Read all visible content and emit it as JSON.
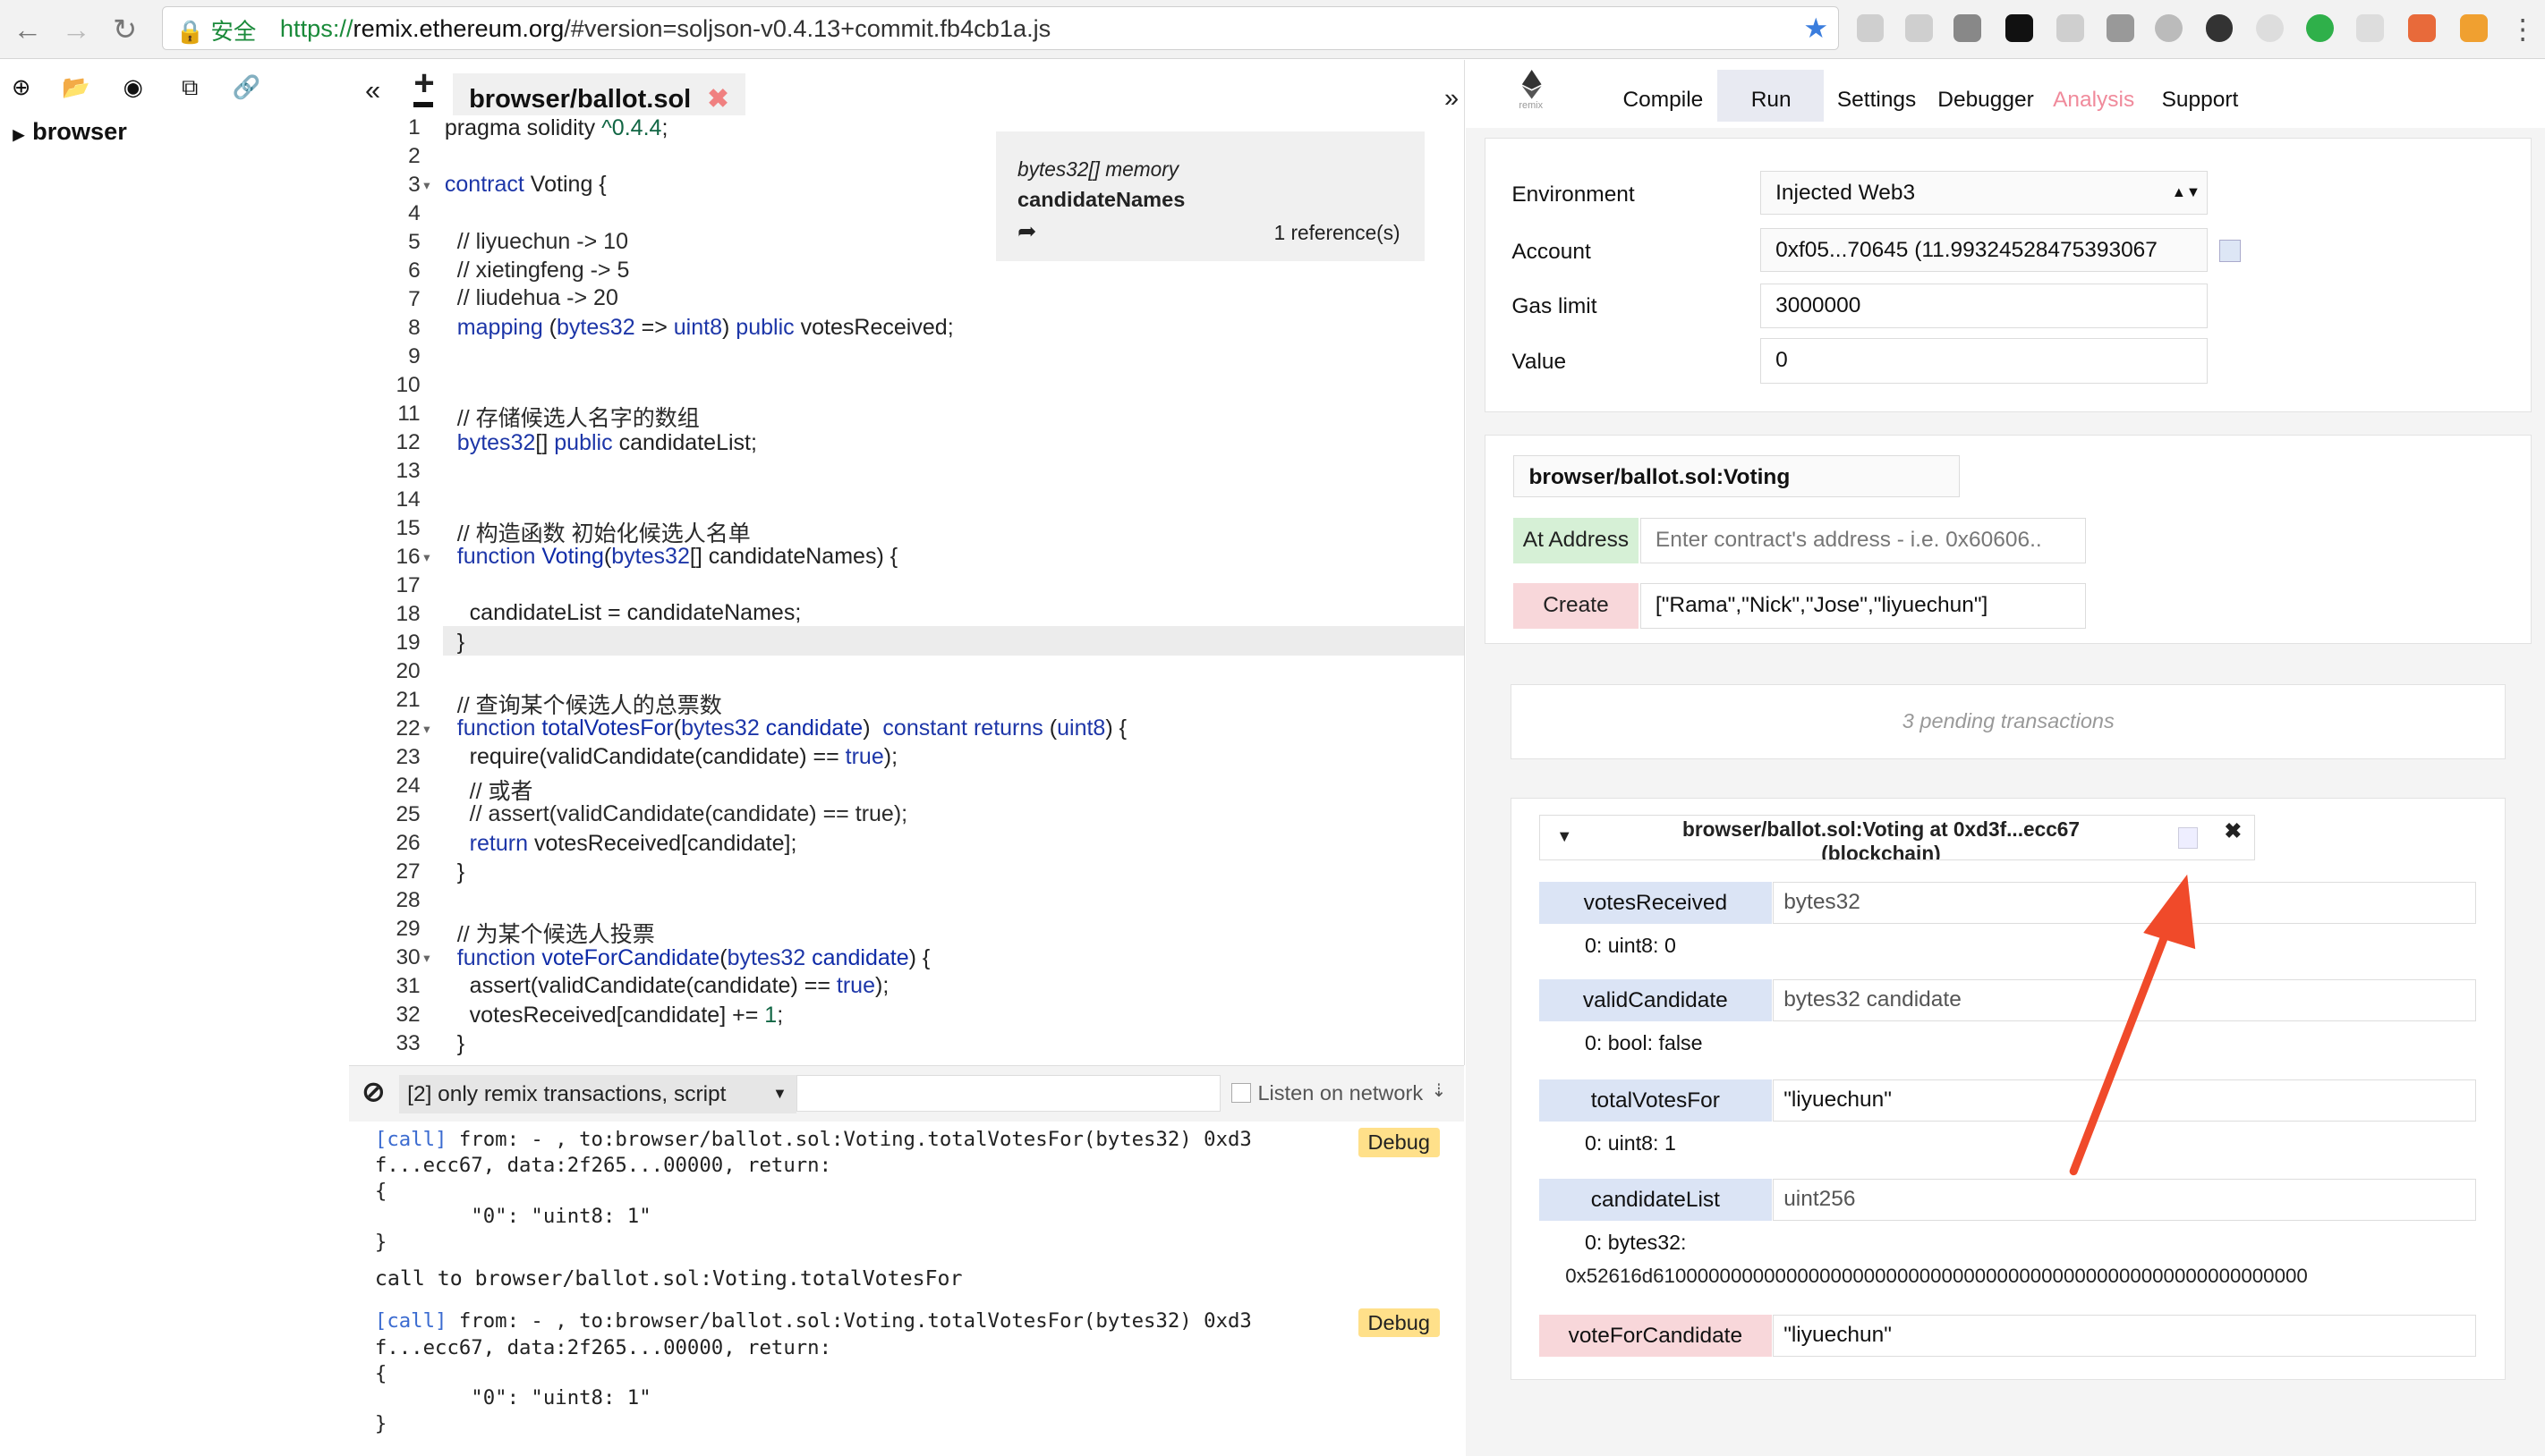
{
  "browser": {
    "secure_label": "安全",
    "url_scheme": "https://",
    "url_host": "remix.ethereum.org",
    "url_path": "/#version=soljson-v0.4.13+commit.fb4cb1a.js"
  },
  "filepanel": {
    "root_label": "browser"
  },
  "editor": {
    "tab_label": "browser/ballot.sol",
    "tab_close": "✖",
    "collapse_left": "«",
    "add_file": "+",
    "collapse_right": "»",
    "tooltip": {
      "type": "bytes32[] memory",
      "name": "candidateNames",
      "refs": "1 reference(s)"
    },
    "line_numbers": [
      "1",
      "2",
      "3",
      "4",
      "5",
      "6",
      "7",
      "8",
      "9",
      "10",
      "11",
      "12",
      "13",
      "14",
      "15",
      "16",
      "17",
      "18",
      "19",
      "20",
      "21",
      "22",
      "23",
      "24",
      "25",
      "26",
      "27",
      "28",
      "29",
      "30",
      "31",
      "32",
      "33"
    ],
    "code": {
      "l1a": "pragma solidity ",
      "l1b": "^0.4.4",
      "l1c": ";",
      "l3a": "contract",
      "l3b": " Voting {",
      "l5": "  // liyuechun -> 10",
      "l6": "  // xietingfeng -> 5",
      "l7": "  // liudehua -> 20",
      "l8a": "  mapping",
      "l8b": " (",
      "l8c": "bytes32",
      "l8d": " => ",
      "l8e": "uint8",
      "l8f": ") ",
      "l8g": "public",
      "l8h": " votesReceived;",
      "l11": "  // 存储候选人名字的数组",
      "l12a": "  bytes32",
      "l12b": "[] ",
      "l12c": "public",
      "l12d": " candidateList;",
      "l15": "  // 构造函数 初始化候选人名单",
      "l16a": "  function",
      "l16b": " Voting",
      "l16c": "(",
      "l16d": "bytes32",
      "l16e": "[] candidateNames) {",
      "l18": "    candidateList = candidateNames;",
      "l19": "  }",
      "l21": "  // 查询某个候选人的总票数",
      "l22a": "  function",
      "l22b": " totalVotesFor",
      "l22c": "(",
      "l22d": "bytes32",
      "l22e": " candidate",
      "l22f": ")  ",
      "l22g": "constant",
      "l22h": " ",
      "l22i": "returns",
      "l22j": " (",
      "l22k": "uint8",
      "l22l": ") {",
      "l23a": "    require(validCandidate(candidate) == ",
      "l23b": "true",
      "l23c": ");",
      "l24": "    // 或者",
      "l25": "    // assert(validCandidate(candidate) == true);",
      "l26a": "    return",
      "l26b": " votesReceived[candidate];",
      "l27": "  }",
      "l29": "  // 为某个候选人投票",
      "l30a": "  function",
      "l30b": " voteForCandidate",
      "l30c": "(",
      "l30d": "bytes32",
      "l30e": " candidate",
      "l30f": ") {",
      "l31a": "    assert(validCandidate(candidate) == ",
      "l31b": "true",
      "l31c": ");",
      "l32a": "    votesReceived[candidate] += ",
      "l32b": "1",
      "l32c": ";",
      "l33": "  }"
    }
  },
  "terminal": {
    "filter_label": "[2] only remix transactions, script",
    "listen_label": "Listen on network",
    "log1_call": "[call]",
    "log1_line1": " from: - , to:browser/ballot.sol:Voting.totalVotesFor(bytes32) 0xd3",
    "log1_line2": "f...ecc67, data:2f265...00000, return:",
    "log1_line3": "{",
    "log1_line4": "        \"0\": \"uint8: 1\"",
    "log1_line5": "}",
    "call_to": "call to browser/ballot.sol:Voting.totalVotesFor",
    "log2_call": "[call]",
    "log2_line1": " from: - , to:browser/ballot.sol:Voting.totalVotesFor(bytes32) 0xd3",
    "log2_line2": "f...ecc67, data:2f265...00000, return:",
    "log2_line3": "{",
    "log2_line4": "        \"0\": \"uint8: 1\"",
    "log2_line5": "}",
    "debug_label": "Debug"
  },
  "rightpanel": {
    "tabs": [
      "Compile",
      "Run",
      "Settings",
      "Debugger",
      "Analysis",
      "Support"
    ],
    "logo_text": "remix",
    "environment_label": "Environment",
    "environment_value": "Injected Web3",
    "account_label": "Account",
    "account_value": "0xf05...70645 (11.99324528475393067",
    "gas_label": "Gas limit",
    "gas_value": "3000000",
    "value_label": "Value",
    "value_value": "0",
    "contract_select": "browser/ballot.sol:Voting",
    "at_address_label": "At Address",
    "at_address_placeholder": "Enter contract's address - i.e. 0x60606..",
    "create_label": "Create",
    "create_value": "[\"Rama\",\"Nick\",\"Jose\",\"liyuechun\"]",
    "pending": "3 pending transactions",
    "instance_title": "browser/ballot.sol:Voting at 0xd3f...ecc67",
    "instance_subtitle": "(blockchain)",
    "functions": [
      {
        "name": "votesReceived",
        "input": "bytes32",
        "output": "0: uint8: 0"
      },
      {
        "name": "validCandidate",
        "input": "bytes32 candidate",
        "output": "0: bool: false"
      },
      {
        "name": "totalVotesFor",
        "input": "\"liyuechun\"",
        "output": "0: uint8: 1"
      },
      {
        "name": "candidateList",
        "input": "uint256",
        "output": "0: bytes32:"
      },
      {
        "name": "voteForCandidate",
        "input": "\"liyuechun\"",
        "output": ""
      }
    ],
    "candidate_list_value": "0x52616d61000000000000000000000000000000000000000000000000000000000"
  },
  "colors": {
    "call_btn_blue": "#dbe4f5",
    "transact_btn_red": "#f8d7da",
    "create_btn_red": "#f8d7da",
    "at_address_green": "#d6f0d6",
    "analysis_tab": "#f08a9b",
    "annotation_arrow": "#f04a2a"
  }
}
